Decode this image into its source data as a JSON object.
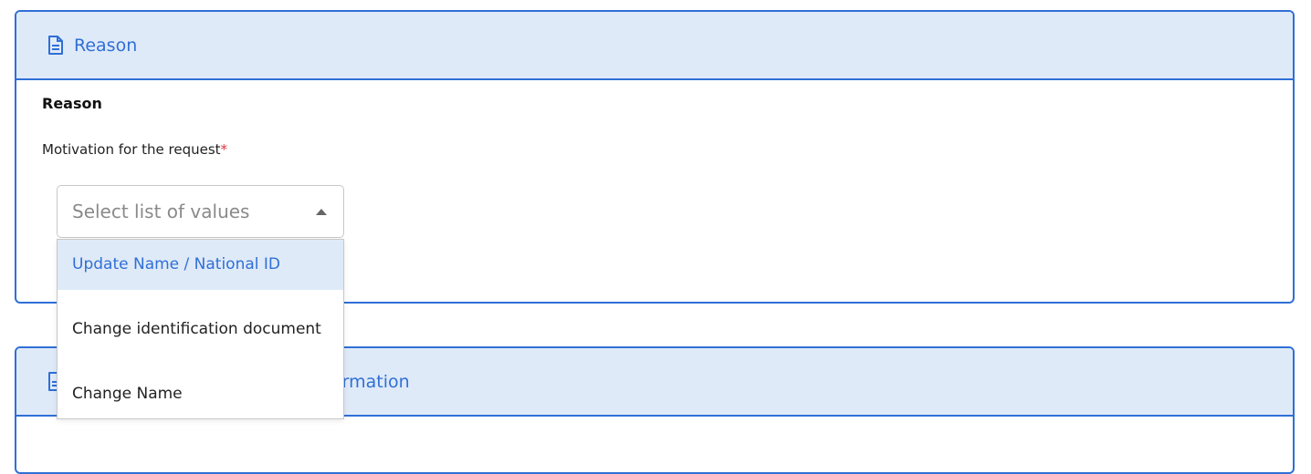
{
  "cards": {
    "reason": {
      "title": "Reason",
      "icon": "document-icon"
    },
    "second": {
      "title_visible": "ormation",
      "icon": "document-icon"
    }
  },
  "form": {
    "section_title": "Reason",
    "field_label": "Motivation for the request",
    "required_mark": "*",
    "select_placeholder": "Select list of values"
  },
  "dropdown": {
    "options": [
      "Update Name / National ID",
      "Change identification document",
      "Change Name"
    ],
    "highlighted_index": 0
  },
  "colors": {
    "accent": "#2f6fd6",
    "header_bg": "#dfeaf8",
    "required": "#e0333a"
  }
}
